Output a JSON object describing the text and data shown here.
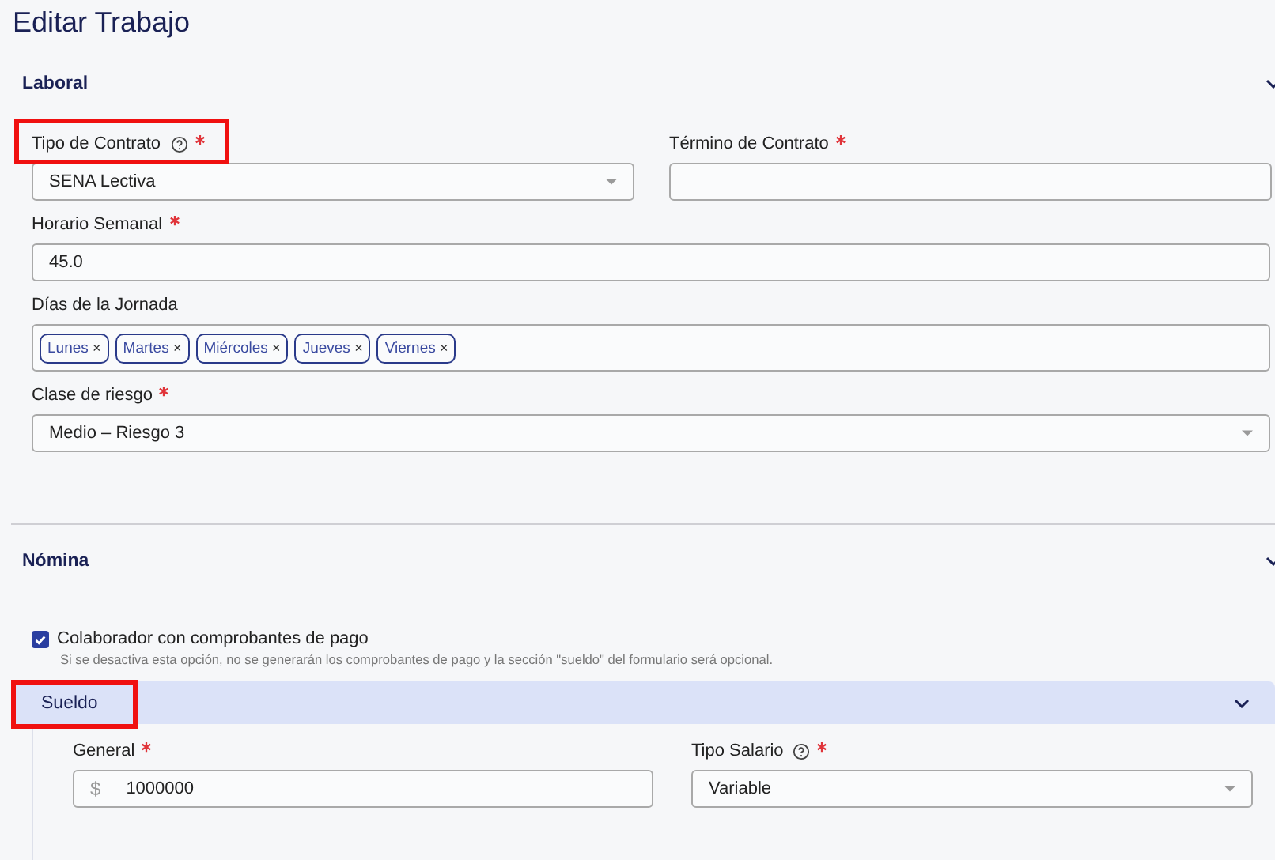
{
  "title": "Editar Trabajo",
  "sections": [
    {
      "title": "Laboral",
      "expanded": true
    },
    {
      "title": "Nómina",
      "expanded": true
    }
  ],
  "laboral": {
    "contract_type": {
      "label": "Tipo de Contrato",
      "required": true,
      "help": true,
      "value": "SENA Lectiva",
      "annotated": true
    },
    "contract_end": {
      "label": "Término de Contrato",
      "required": true
    },
    "weekly_hours": {
      "label": "Horario Semanal",
      "required": true,
      "value": "45.0"
    },
    "days": {
      "label": "Días de la Jornada",
      "tags": [
        {
          "label": "Lunes",
          "remove": "×"
        },
        {
          "label": "Martes",
          "remove": "×"
        },
        {
          "label": "Miércoles",
          "remove": "×"
        },
        {
          "label": "Jueves",
          "remove": "×"
        },
        {
          "label": "Viernes",
          "remove": "×"
        }
      ]
    },
    "risk_class": {
      "label": "Clase de riesgo",
      "required": true,
      "value": "Medio – Riesgo 3"
    }
  },
  "nomina": {
    "payslips": {
      "label": "Colaborador con comprobantes de pago",
      "checked": true,
      "hint": "Si se desactiva esta opción, no se generarán los comprobantes de pago y la sección \"sueldo\" del formulario será opcional."
    },
    "salary": {
      "title": "Sueldo",
      "expanded": true,
      "annotated": true,
      "general": {
        "label": "General",
        "required": true,
        "prefix": "$",
        "value": "1000000"
      },
      "salary_type": {
        "label": "Tipo Salario",
        "required": true,
        "help": true,
        "value": "Variable"
      }
    }
  }
}
